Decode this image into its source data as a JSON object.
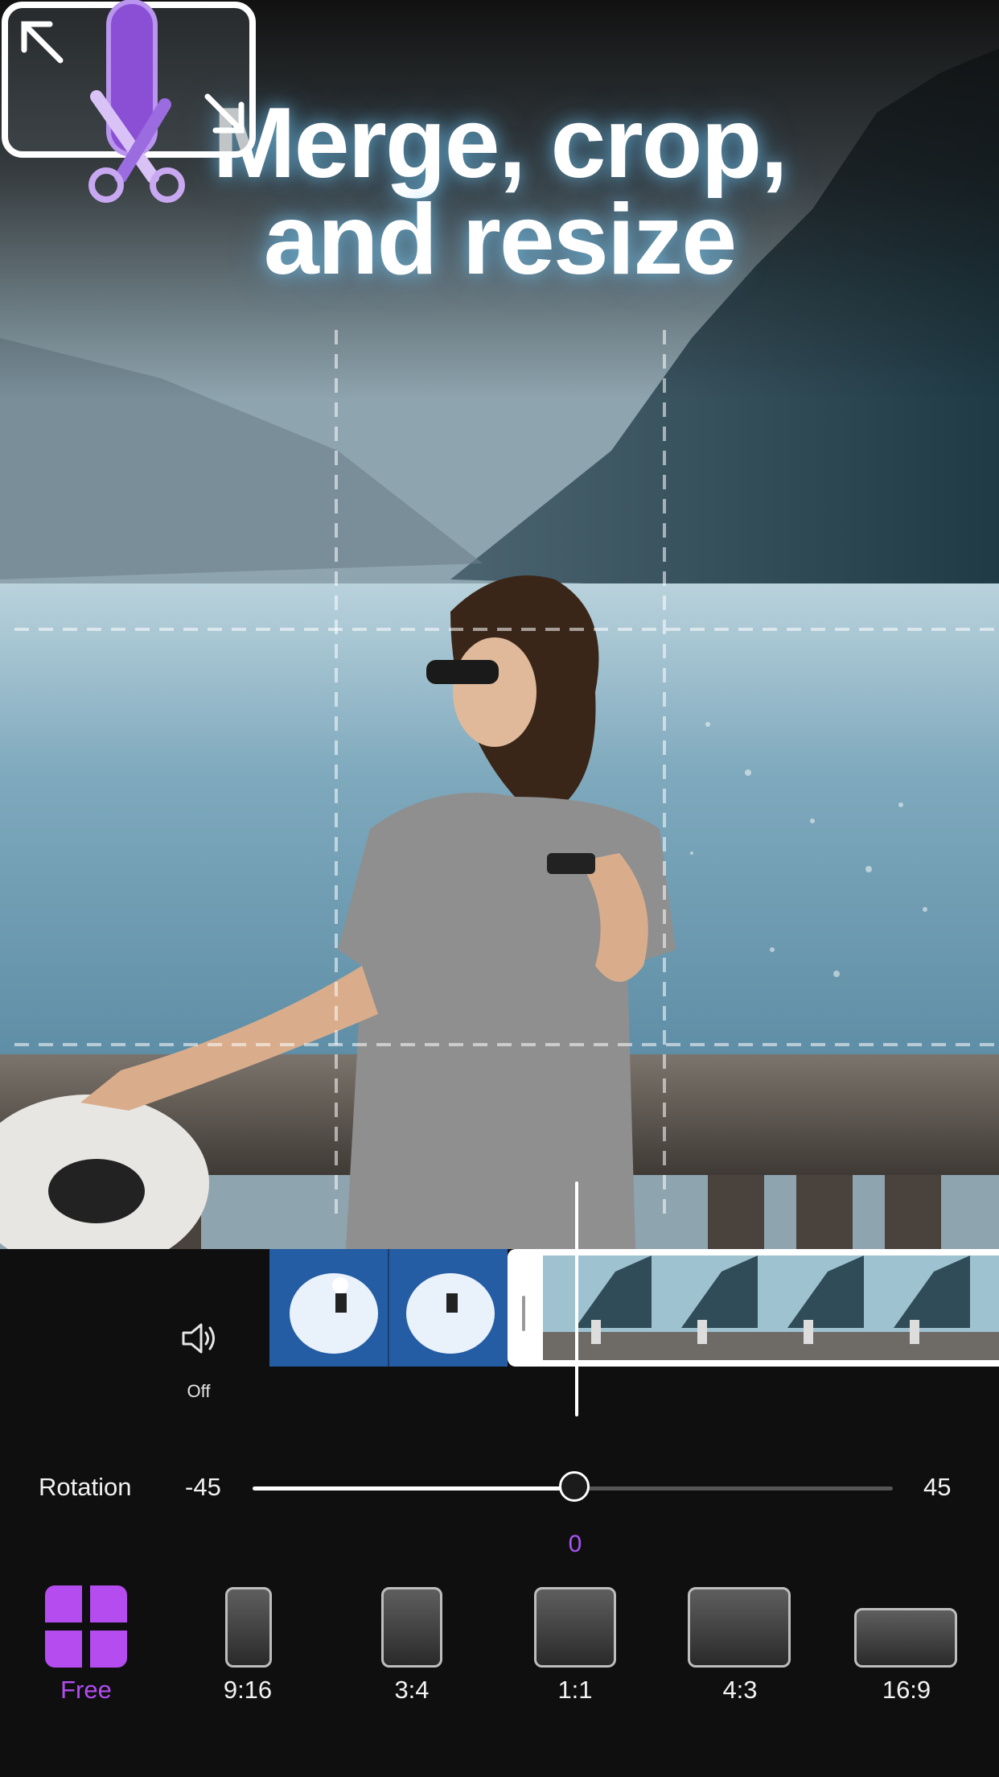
{
  "header": {
    "title_line1": "Merge, crop,",
    "title_line2": "and resize"
  },
  "audio": {
    "icon": "speaker-icon",
    "label": "Off"
  },
  "rotation": {
    "label": "Rotation",
    "min": "-45",
    "max": "45",
    "value": "0",
    "fraction": 0.5
  },
  "ratios": [
    {
      "label": "Free",
      "selected": true
    },
    {
      "label": "9:16",
      "selected": false
    },
    {
      "label": "3:4",
      "selected": false
    },
    {
      "label": "1:1",
      "selected": false
    },
    {
      "label": "4:3",
      "selected": false
    },
    {
      "label": "16:9",
      "selected": false
    }
  ],
  "colors": {
    "accent": "#a855f7",
    "background": "#0f0f10"
  }
}
